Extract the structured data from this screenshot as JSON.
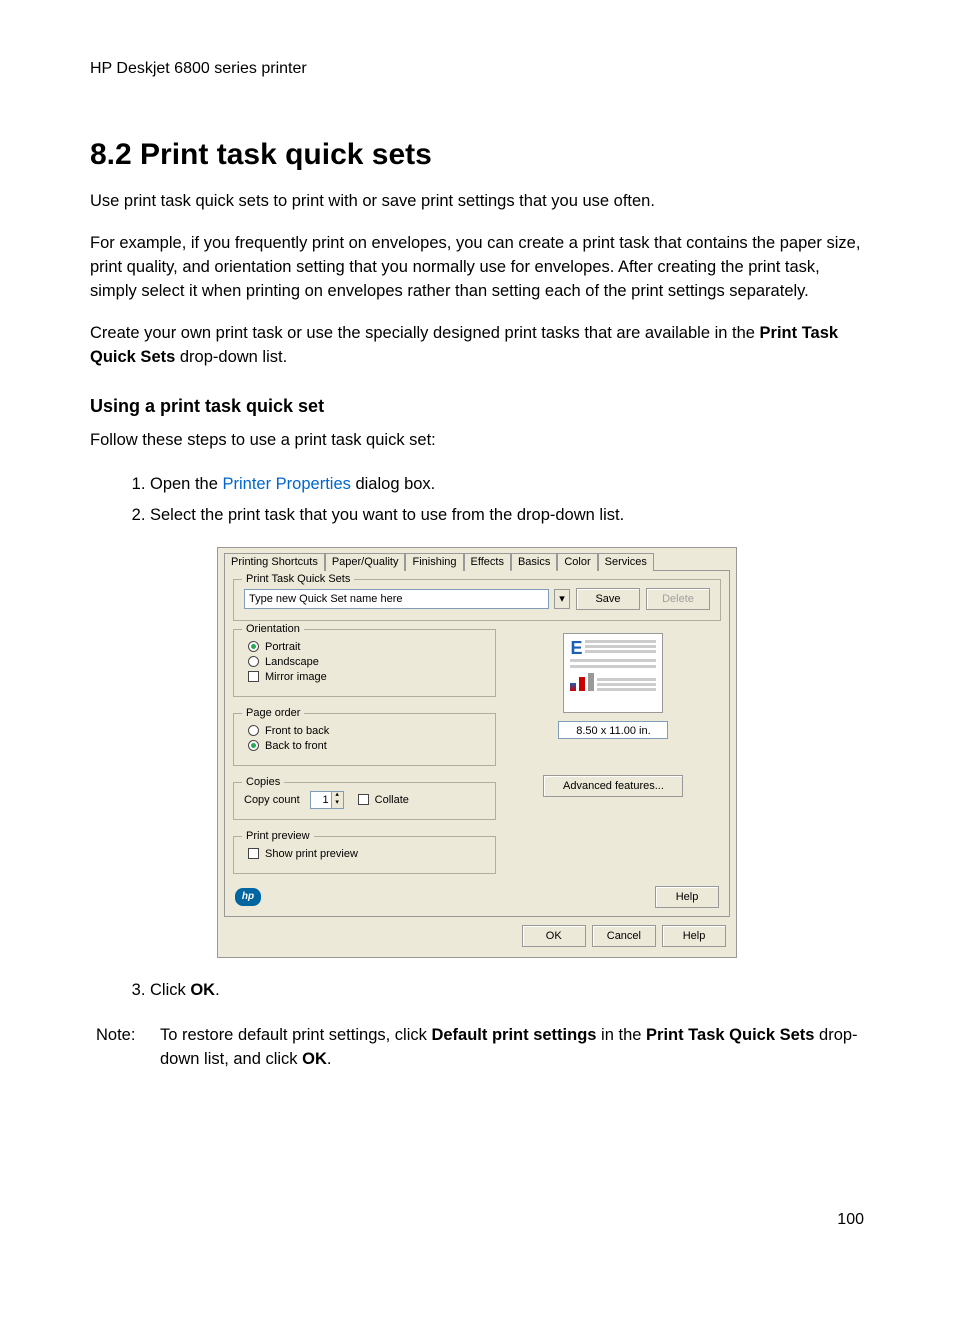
{
  "header": "HP Deskjet 6800 series printer",
  "title": "8.2  Print task quick sets",
  "para1": "Use print task quick sets to print with or save print settings that you use often.",
  "para2": "For example, if you frequently print on envelopes, you can create a print task that contains the paper size, print quality, and orientation setting that you normally use for envelopes. After creating the print task, simply select it when printing on envelopes rather than setting each of the print settings separately.",
  "para3_pre": "Create your own print task or use the specially designed print tasks that are available in the ",
  "para3_bold": "Print Task Quick Sets",
  "para3_post": " drop-down list.",
  "subhead": "Using a print task quick set",
  "intro2": "Follow these steps to use a print task quick set:",
  "steps": {
    "s1_pre": "Open the ",
    "s1_link": "Printer Properties",
    "s1_post": " dialog box.",
    "s2": "Select the print task that you want to use from the drop-down list.",
    "s3_pre": "Click ",
    "s3_bold": "OK",
    "s3_post": "."
  },
  "dialog": {
    "tabs": [
      "Printing Shortcuts",
      "Paper/Quality",
      "Finishing",
      "Effects",
      "Basics",
      "Color",
      "Services"
    ],
    "selected_tab": "Basics",
    "quickset_legend": "Print Task Quick Sets",
    "quickset_value": "Type new Quick Set name here",
    "save": "Save",
    "delete": "Delete",
    "orientation": {
      "legend": "Orientation",
      "portrait": "Portrait",
      "landscape": "Landscape",
      "mirror": "Mirror image"
    },
    "pageorder": {
      "legend": "Page order",
      "ftb": "Front to back",
      "btf": "Back to front"
    },
    "copies": {
      "legend": "Copies",
      "copycount": "Copy count",
      "value": "1",
      "collate": "Collate"
    },
    "preview": {
      "legend": "Print preview",
      "show": "Show print preview"
    },
    "pagesize": "8.50 x 11.00 in.",
    "advanced": "Advanced features...",
    "hp": "hp",
    "help": "Help",
    "ok": "OK",
    "cancel": "Cancel",
    "help2": "Help"
  },
  "note": {
    "label": "Note:",
    "pre": "To restore default print settings, click ",
    "b1": "Default print settings",
    "mid1": " in the ",
    "b2": "Print Task Quick Sets",
    "mid2": " drop-down list, and click ",
    "b3": "OK",
    "post": "."
  },
  "page_number": "100"
}
